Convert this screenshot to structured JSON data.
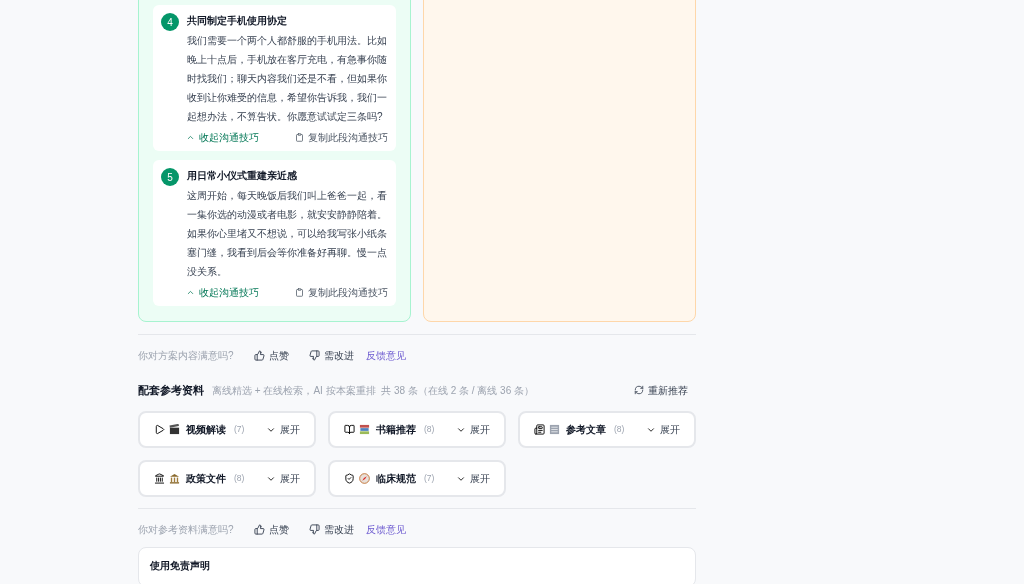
{
  "tips": [
    {
      "number": "4",
      "title": "共同制定手机使用协定",
      "body": "我们需要一个两个人都舒服的手机用法。比如晚上十点后，手机放在客厅充电，有急事你随时找我们；聊天内容我们还是不看，但如果你收到让你难受的信息，希望你告诉我，我们一起想办法，不算告状。你愿意试试定三条吗?",
      "collapse": "收起沟通技巧",
      "copy": "复制此段沟通技巧"
    },
    {
      "number": "5",
      "title": "用日常小仪式重建亲近感",
      "body": "这周开始，每天晚饭后我们叫上爸爸一起，看一集你选的动漫或者电影，就安安静静陪着。如果你心里堵又不想说，可以给我写张小纸条塞门缝，我看到后会等你准备好再聊。慢一点没关系。",
      "collapse": "收起沟通技巧",
      "copy": "复制此段沟通技巧"
    }
  ],
  "plan_feedback": {
    "question": "你对方案内容满意吗?",
    "like": "点赞",
    "improve": "需改进",
    "feedback": "反馈意见"
  },
  "references": {
    "title": "配套参考资料",
    "subtitle": "离线精选 + 在线检索，AI 按本案重排  共 38 条（在线 2 条 / 离线 36 条）",
    "refresh": "重新推荐",
    "categories": [
      {
        "kind": "video",
        "label": "视频解读",
        "count": "(7)",
        "toggle": "展开"
      },
      {
        "kind": "book",
        "label": "书籍推荐",
        "count": "(8)",
        "toggle": "展开"
      },
      {
        "kind": "article",
        "label": "参考文章",
        "count": "(8)",
        "toggle": "展开"
      },
      {
        "kind": "policy",
        "label": "政策文件",
        "count": "(8)",
        "toggle": "展开"
      },
      {
        "kind": "clinical",
        "label": "临床规范",
        "count": "(7)",
        "toggle": "展开"
      }
    ]
  },
  "reference_feedback": {
    "question": "你对参考资料满意吗?",
    "like": "点赞",
    "improve": "需改进",
    "feedback": "反馈意见"
  },
  "disclaimer": {
    "title": "使用免责声明"
  }
}
